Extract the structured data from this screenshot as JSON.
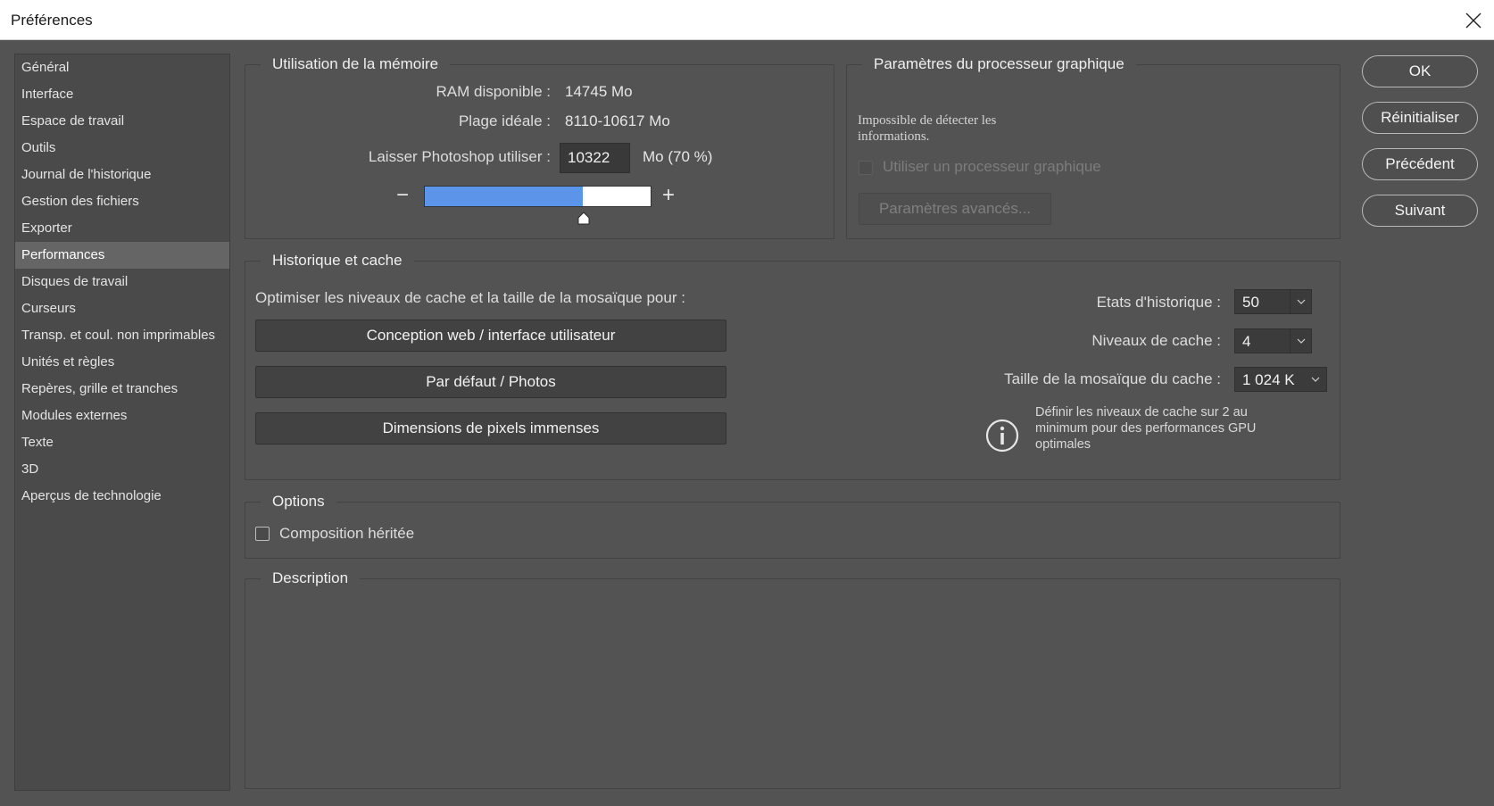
{
  "window": {
    "title": "Préférences"
  },
  "sidebar": {
    "items": [
      {
        "label": "Général"
      },
      {
        "label": "Interface"
      },
      {
        "label": "Espace de travail"
      },
      {
        "label": "Outils"
      },
      {
        "label": "Journal de l'historique"
      },
      {
        "label": "Gestion des fichiers"
      },
      {
        "label": "Exporter"
      },
      {
        "label": "Performances",
        "selected": true
      },
      {
        "label": "Disques de travail"
      },
      {
        "label": "Curseurs"
      },
      {
        "label": "Transp. et coul. non imprimables"
      },
      {
        "label": "Unités et règles"
      },
      {
        "label": "Repères, grille et tranches"
      },
      {
        "label": "Modules externes"
      },
      {
        "label": "Texte"
      },
      {
        "label": "3D"
      },
      {
        "label": "Aperçus de technologie"
      }
    ]
  },
  "memory": {
    "legend": "Utilisation de la mémoire",
    "ram_label": "RAM disponible :",
    "ram_value": "14745 Mo",
    "ideal_label": "Plage idéale :",
    "ideal_value": "8110-10617 Mo",
    "let_label": "Laisser Photoshop utiliser :",
    "let_value": "10322",
    "let_unit": "Mo (70 %)",
    "minus": "−",
    "plus": "+",
    "slider_fraction": 0.7
  },
  "gpu": {
    "legend": "Paramètres du processeur graphique",
    "info": "Impossible de détecter les informations.",
    "use_gpu_label": "Utiliser un processeur graphique",
    "use_gpu_checked": false,
    "advanced_button": "Paramètres avancés..."
  },
  "history": {
    "legend": "Historique et cache",
    "optimize_label": "Optimiser les niveaux de cache et la taille de la mosaïque pour :",
    "presets": [
      "Conception web / interface utilisateur",
      "Par défaut / Photos",
      "Dimensions de pixels immenses"
    ],
    "states_label": "Etats d'historique :",
    "states_value": "50",
    "levels_label": "Niveaux de cache :",
    "levels_value": "4",
    "tile_label": "Taille de la mosaïque du cache :",
    "tile_value": "1 024 K",
    "note": "Définir les niveaux de cache sur 2 au minimum pour des performances GPU optimales"
  },
  "options": {
    "legend": "Options",
    "legacy_label": "Composition héritée",
    "legacy_checked": false
  },
  "description": {
    "legend": "Description"
  },
  "buttons": {
    "ok": "OK",
    "reset": "Réinitialiser",
    "prev": "Précédent",
    "next": "Suivant"
  },
  "colors": {
    "background": "#535353",
    "slider_fill": "#5b94e8",
    "sidebar_selected": "#656565"
  }
}
